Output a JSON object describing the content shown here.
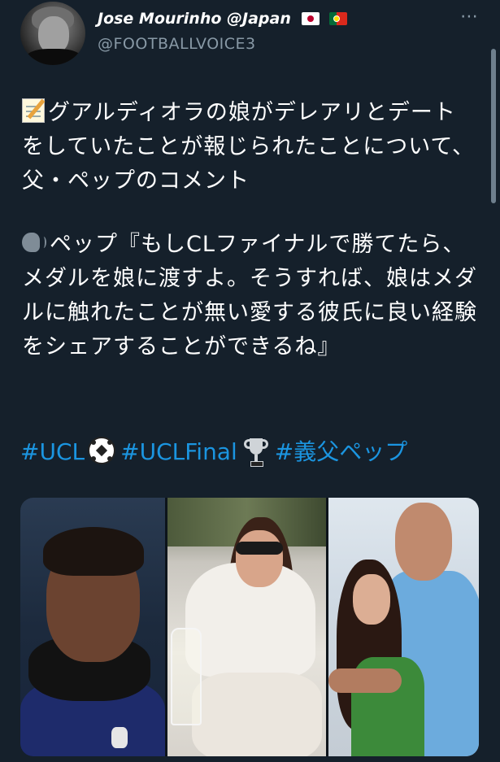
{
  "tweet": {
    "author": {
      "display_name": "Jose Mourinho @Japan",
      "handle": "@FOOTBALLVOICE3",
      "flags": [
        "japan-flag",
        "portugal-flag"
      ]
    },
    "more_icon": "⋯",
    "paragraph1": "グアルディオラの娘がデレアリとデートをしていたことが報じられたことについて、父・ペップのコメント",
    "paragraph2": "ペップ『もしCLファイナルで勝てたら、メダルを娘に渡すよ。そうすれば、娘はメダルに触れたことが無い愛する彼氏に良い経験をシェアすることができるね』",
    "hashtags": [
      "#UCL",
      "#UCLFinal",
      "#義父ペップ"
    ],
    "emojis": {
      "p1": "memo-emoji",
      "p2": "speaking-head-emoji",
      "after_tag1": "soccer-ball-emoji",
      "after_tag2": "trophy-emoji"
    },
    "media": {
      "count": 3,
      "photos": [
        "player-photo",
        "woman-photo",
        "father-daughter-photo"
      ]
    }
  },
  "colors": {
    "background": "#15202b",
    "text": "#ffffff",
    "secondary": "#8899a6",
    "link": "#1b95e0"
  }
}
